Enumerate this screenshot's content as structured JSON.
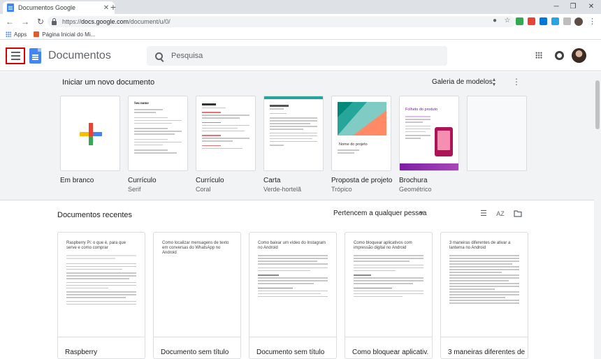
{
  "browser": {
    "tab_title": "Documentos Google",
    "tab_close": "✕",
    "new_tab": "+",
    "url_scheme": "https://",
    "url_host": "docs.google.com",
    "url_path": "/document/u/0/",
    "back_glyph": "←",
    "forward_glyph": "→",
    "reload_glyph": "↻",
    "minimize_glyph": "─",
    "restore_glyph": "❐",
    "close_glyph": "✕",
    "menu_glyph": "⋮",
    "star_glyph": "☆",
    "bookmarks": [
      {
        "label": "Apps"
      },
      {
        "label": "Página Inicial do Mi..."
      }
    ]
  },
  "header": {
    "app_name": "Documentos",
    "search_placeholder": "Pesquisa"
  },
  "gallery": {
    "heading": "Iniciar um novo documento",
    "models_label": "Galeria de modelos",
    "unfold_glyph": "⌃\n⌄",
    "more_glyph": "⋮",
    "templates": [
      {
        "name": "Em branco",
        "sub": ""
      },
      {
        "name": "Currículo",
        "sub": "Serif"
      },
      {
        "name": "Currículo",
        "sub": "Coral"
      },
      {
        "name": "Carta",
        "sub": "Verde-hortelã"
      },
      {
        "name": "Proposta de projeto",
        "sub": "Trópico"
      },
      {
        "name": "Brochura",
        "sub": "Geométrico"
      }
    ],
    "thumb_text": {
      "resume_serif": "Seu nome",
      "proposal": "Nome do projeto",
      "brochure": "Folheto do produto"
    }
  },
  "recent": {
    "title": "Documentos recentes",
    "owner_filter": "Pertencem a qualquer pessoa",
    "list_view_glyph": "☰",
    "sort_glyph": "A͢Z",
    "folder_glyph": "🗀",
    "docs": [
      {
        "name": "Raspberry",
        "preview_title": "Raspberry Pi: o que é, para que serve e como comprar"
      },
      {
        "name": "Documento sem título",
        "preview_title": "Como localizar mensagens de texto em conversas do WhatsApp no Android"
      },
      {
        "name": "Documento sem título",
        "preview_title": "Como baixar um vídeo do Instagram no Android"
      },
      {
        "name": "Como bloquear aplicativ...",
        "preview_title": "Como bloquear aplicativos com impressão digital no Android"
      },
      {
        "name": "3 maneiras diferentes de ...",
        "preview_title": "3 maneiras diferentes de ativar a lanterna no Android"
      }
    ]
  },
  "colors": {
    "accent_blue": "#4285f4",
    "highlight_red": "#d50000",
    "gallery_bg": "#f1f3f4"
  }
}
